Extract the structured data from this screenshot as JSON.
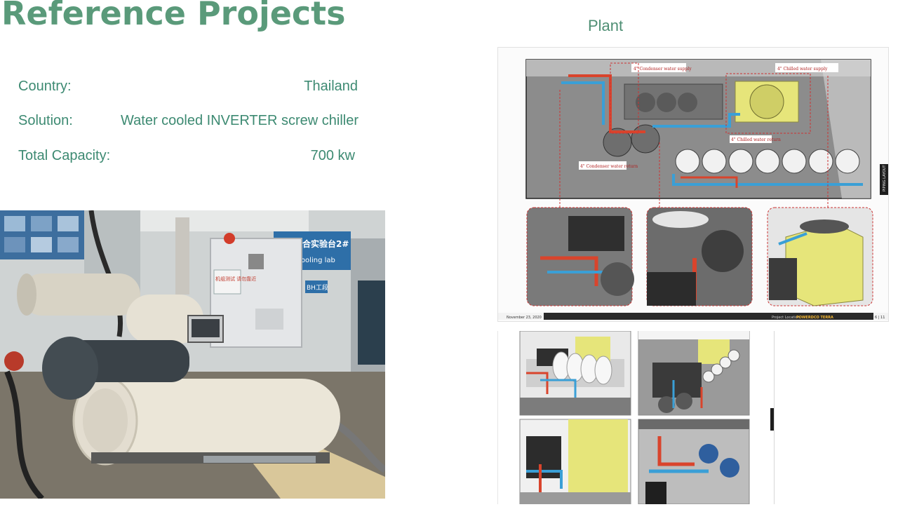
{
  "title": "Reference Projects",
  "info": {
    "country_label": "Country:",
    "country_value": "Thailand",
    "solution_label": "Solution:",
    "solution_value": "Water cooled INVERTER screw chiller",
    "capacity_label": "Total Capacity:",
    "capacity_value": "700 kw"
  },
  "plant_heading": "Plant",
  "photo": {
    "bench_sign": "整机综合实验台2#",
    "bench_sign_en": "er cooling lab",
    "badge": "BH工段",
    "panel_note": "机组测试 请勿靠近"
  },
  "doc": {
    "callouts": [
      "4\" Condenser water supply",
      "4\" Chilled water supply",
      "4\" Chilled water return",
      "4\" Condenser water return"
    ],
    "footer_date": "November 23, 2020",
    "footer_project": "Project Location",
    "footer_brand": "POWERDCO TERRA",
    "footer_page": "6 | 11",
    "side_tab": "PIPING LAYOUT"
  },
  "colors": {
    "title": "#5a9a7a",
    "text": "#3d8a72",
    "pipe_red": "#d9442c",
    "pipe_blue": "#3a9fd6",
    "tower_yellow": "#e6e57a"
  }
}
